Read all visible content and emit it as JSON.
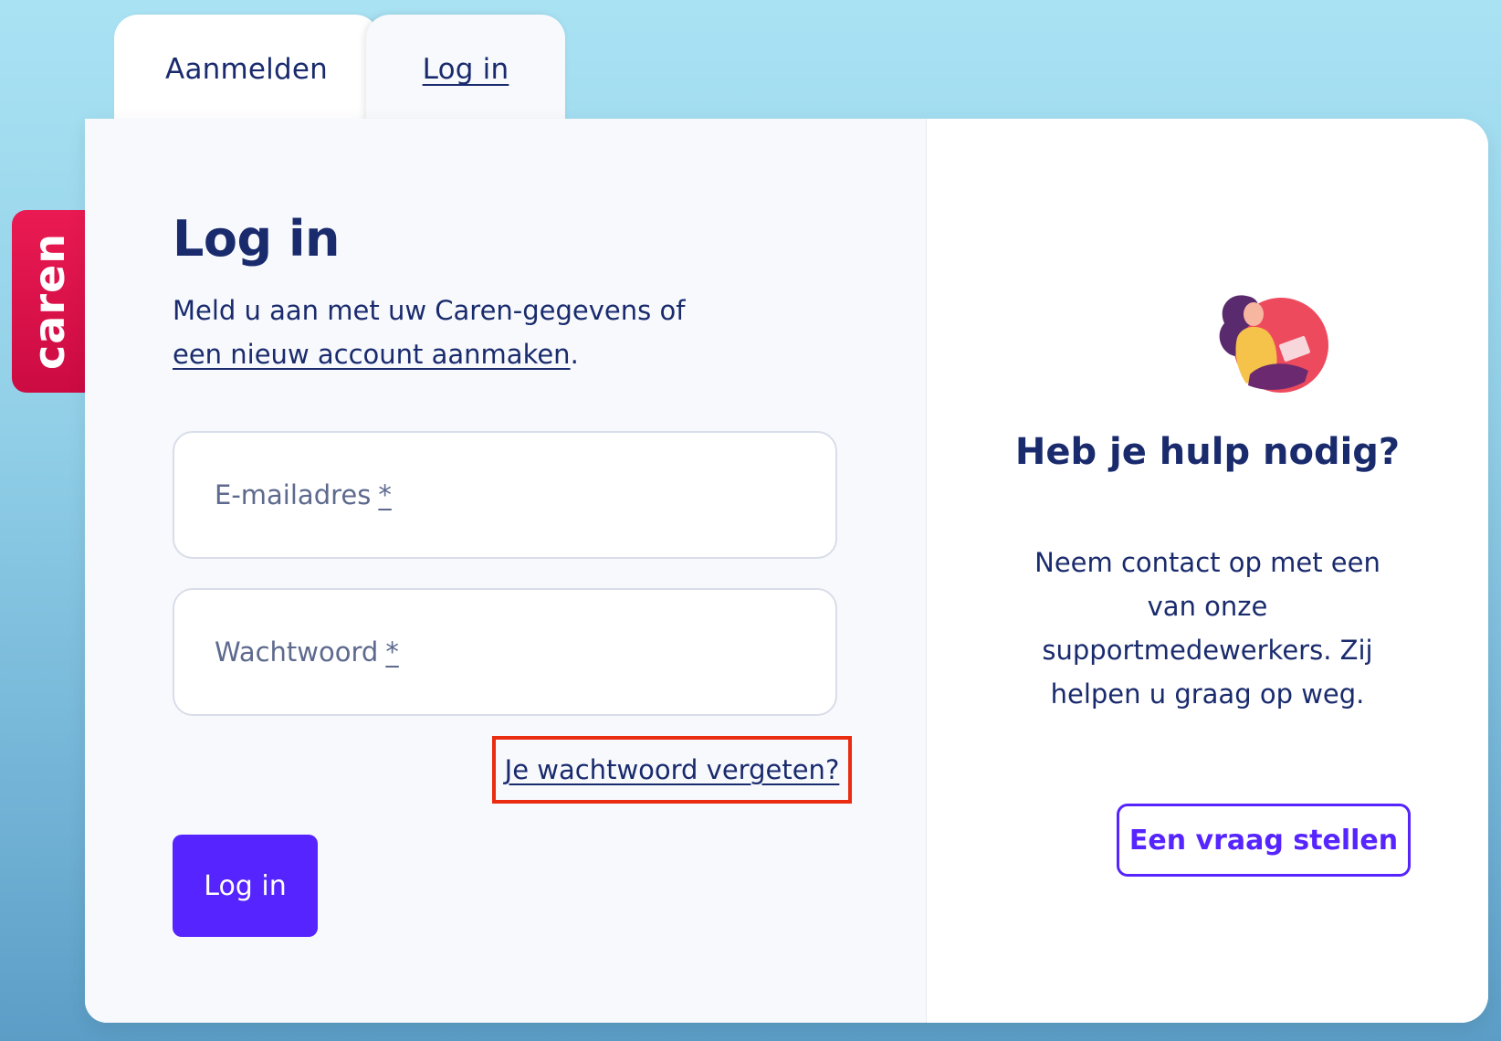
{
  "tabs": {
    "signup_label": "Aanmelden",
    "login_label": "Log in"
  },
  "brand": {
    "name": "caren"
  },
  "login": {
    "title": "Log in",
    "subtitle_text": "Meld u aan met uw Caren-gegevens of",
    "subtitle_link": "een nieuw account aanmaken",
    "subtitle_end": ".",
    "email_label": "E-mailadres",
    "password_label": "Wachtwoord",
    "required_marker": "*",
    "forgot_link": "Je wachtwoord vergeten?",
    "submit_label": "Log in"
  },
  "help": {
    "title": "Heb je hulp nodig?",
    "text": "Neem contact op met een van onze supportmedewerkers. Zij helpen u graag op weg.",
    "button_label": "Een vraag stellen"
  },
  "colors": {
    "brand_red": "#ea1a52",
    "primary_purple": "#5524ff",
    "text_navy": "#1a2b6d",
    "highlight_red": "#ea2c10"
  }
}
